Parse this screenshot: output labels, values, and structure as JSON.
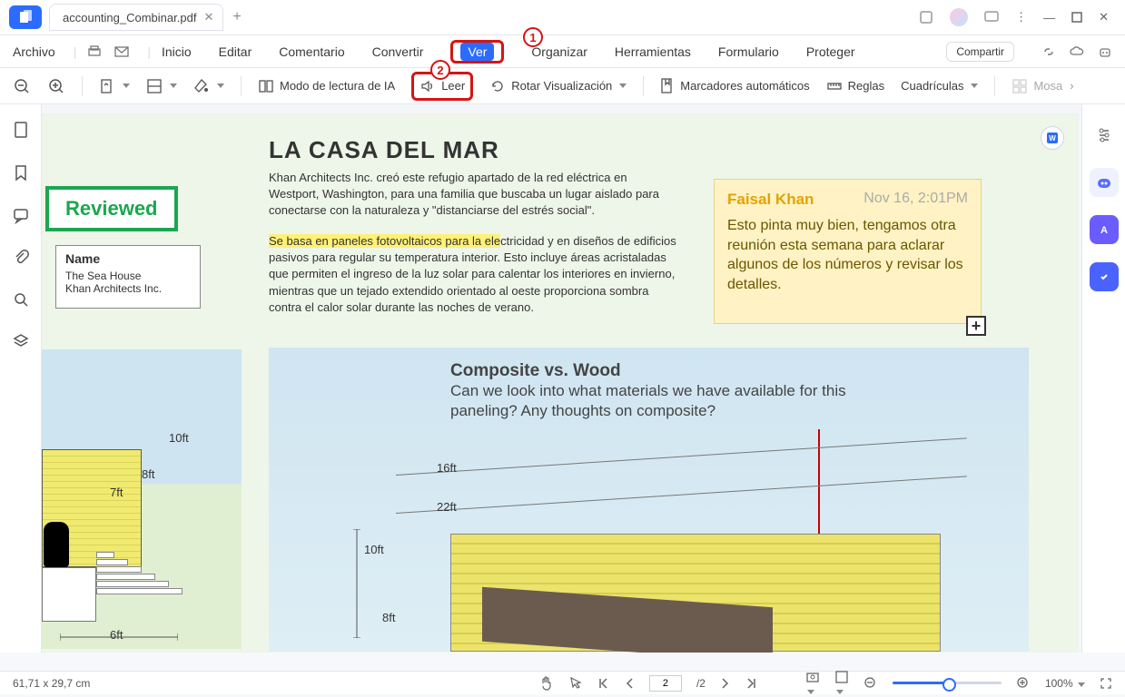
{
  "titlebar": {
    "tab_name": "accounting_Combinar.pdf"
  },
  "menubar": {
    "file": "Archivo",
    "items": [
      "Inicio",
      "Editar",
      "Comentario",
      "Convertir",
      "Ver",
      "Organizar",
      "Herramientas",
      "Formulario",
      "Proteger"
    ],
    "active": "Ver",
    "share": "Compartir"
  },
  "toolbar": {
    "ai_read": "Modo de lectura de IA",
    "read": "Leer",
    "rotate": "Rotar Visualización",
    "bookmarks": "Marcadores automáticos",
    "rulers": "Reglas",
    "grids": "Cuadrículas",
    "mosaic": "Mosa"
  },
  "callouts": {
    "one": "1",
    "two": "2"
  },
  "doc": {
    "reviewed": "Reviewed",
    "name_lbl": "Name",
    "name1": "The Sea House",
    "name2": "Khan Architects Inc.",
    "title": "LA CASA DEL MAR",
    "p1": "Khan Architects Inc. creó este refugio apartado de la red eléctrica en Westport, Washington, para una familia que buscaba un lugar aislado para conectarse con la naturaleza y \"distanciarse del estrés social\".",
    "p2a": "Se basa en paneles fotovoltaicos para la ele",
    "p2b": "ctricidad y en diseños de edificios pasivos para regular su temperatura interior. Esto incluye áreas acristaladas que permiten el ingreso de la luz solar para calentar los interiores en invierno, mientras que un tejado extendido orientado al oeste proporciona sombra contra el calor solar durante las noches de verano.",
    "sticky_who": "Faisal Khan",
    "sticky_when": "Nov 16, 2:01PM",
    "sticky_body": "Esto pinta muy bien, tengamos otra reunión esta semana para aclarar algunos de los números y revisar los detalles.",
    "anno_t": "Composite vs. Wood",
    "anno_b": "Can we look into what materials we have available for this paneling? Any thoughts on composite?",
    "dims_small": {
      "a": "10ft",
      "b": "8ft",
      "c": "7ft",
      "d": "6ft"
    },
    "dims_big": {
      "a": "16ft",
      "b": "22ft",
      "c": "10ft",
      "d": "8ft"
    }
  },
  "status": {
    "coords": "61,71 x 29,7 cm",
    "page": "2",
    "pages": "/2",
    "zoom": "100%"
  }
}
